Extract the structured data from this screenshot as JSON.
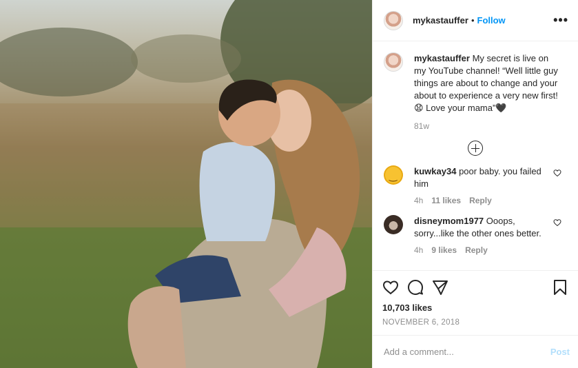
{
  "post": {
    "author": "mykastauffer",
    "follow_label": "Follow",
    "more_label": "•••",
    "caption_text": "My secret is live on my YouTube channel! “Well little guy things are about to change and your about to experience a very new first! 😧 Love your mama”🖤",
    "caption_age": "81w",
    "likes": "10,703 likes",
    "date": "NOVEMBER 6, 2018"
  },
  "comments": [
    {
      "user": "kuwkay34",
      "text": "poor baby. you failed him",
      "age": "4h",
      "likes": "11 likes",
      "reply": "Reply"
    },
    {
      "user": "disneymom1977",
      "text": "Ooops, sorry...like the other ones better.",
      "age": "4h",
      "likes": "9 likes",
      "reply": "Reply"
    }
  ],
  "composer": {
    "placeholder": "Add a comment...",
    "post_label": "Post"
  },
  "icons": {
    "like": "heart-icon",
    "comment": "speech-bubble-icon",
    "share": "paper-plane-icon",
    "save": "bookmark-icon",
    "load_more": "plus-circle-icon"
  },
  "colors": {
    "accent": "#0095f6",
    "post_disabled": "#b2dffc",
    "muted": "#8e8e8e"
  }
}
